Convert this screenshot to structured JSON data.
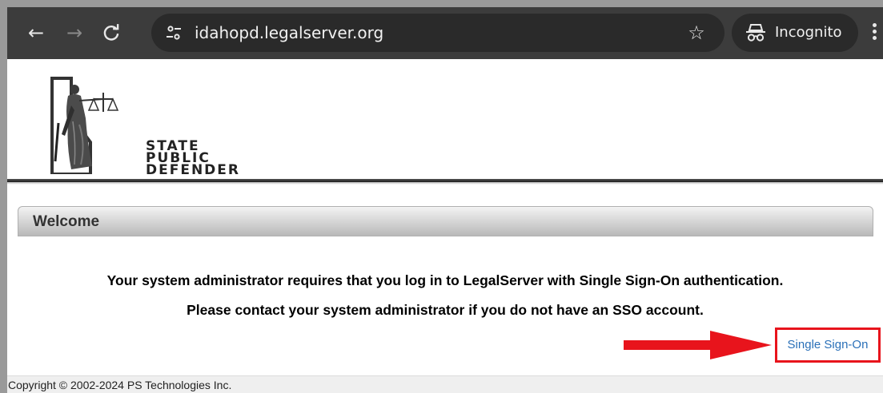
{
  "browser": {
    "url": "idahopd.legalserver.org",
    "incognito_label": "Incognito",
    "icons": {
      "back": "arrow-left-icon",
      "forward": "arrow-right-icon",
      "reload": "reload-icon",
      "site_info": "tune-icon",
      "bookmark": "star-icon",
      "incognito": "incognito-icon",
      "menu": "kebab-menu-icon"
    }
  },
  "logo": {
    "line1": "STATE",
    "line2": "PUBLIC",
    "line3": "DEFENDER"
  },
  "welcome": {
    "title": "Welcome"
  },
  "messages": {
    "line1": "Your system administrator requires that you log in to LegalServer with Single Sign-On authentication.",
    "line2": "Please contact your system administrator if you do not have an SSO account."
  },
  "sso": {
    "link_label": "Single Sign-On",
    "highlight_color": "#e8141c"
  },
  "footer": {
    "copyright": "Copyright © 2002-2024 PS Technologies Inc."
  }
}
